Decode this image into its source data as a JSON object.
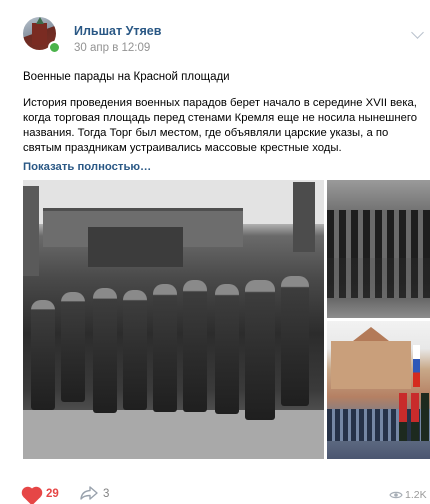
{
  "post": {
    "author": "Ильшат Утяев",
    "date": "30 апр в 12:09",
    "title": "Военные парады на Красной площади",
    "body": "История проведения военных парадов берет начало в середине XVII века, когда торговая площадь перед стенами Кремля еще не носила нынешнего названия. Тогда Торг был местом, где объявляли царские указы, а по святым праздникам устраивались массовые крестные ходы.",
    "show_more": "Показать полностью…"
  },
  "footer": {
    "likes": "29",
    "shares": "3",
    "views": "1.2K"
  },
  "icons": {
    "like": "heart-icon",
    "share": "share-arrow-icon",
    "views": "eye-icon",
    "menu": "chevron-down-icon"
  },
  "colors": {
    "link": "#2a5885",
    "like": "#e64646",
    "online": "#4bb34b"
  }
}
